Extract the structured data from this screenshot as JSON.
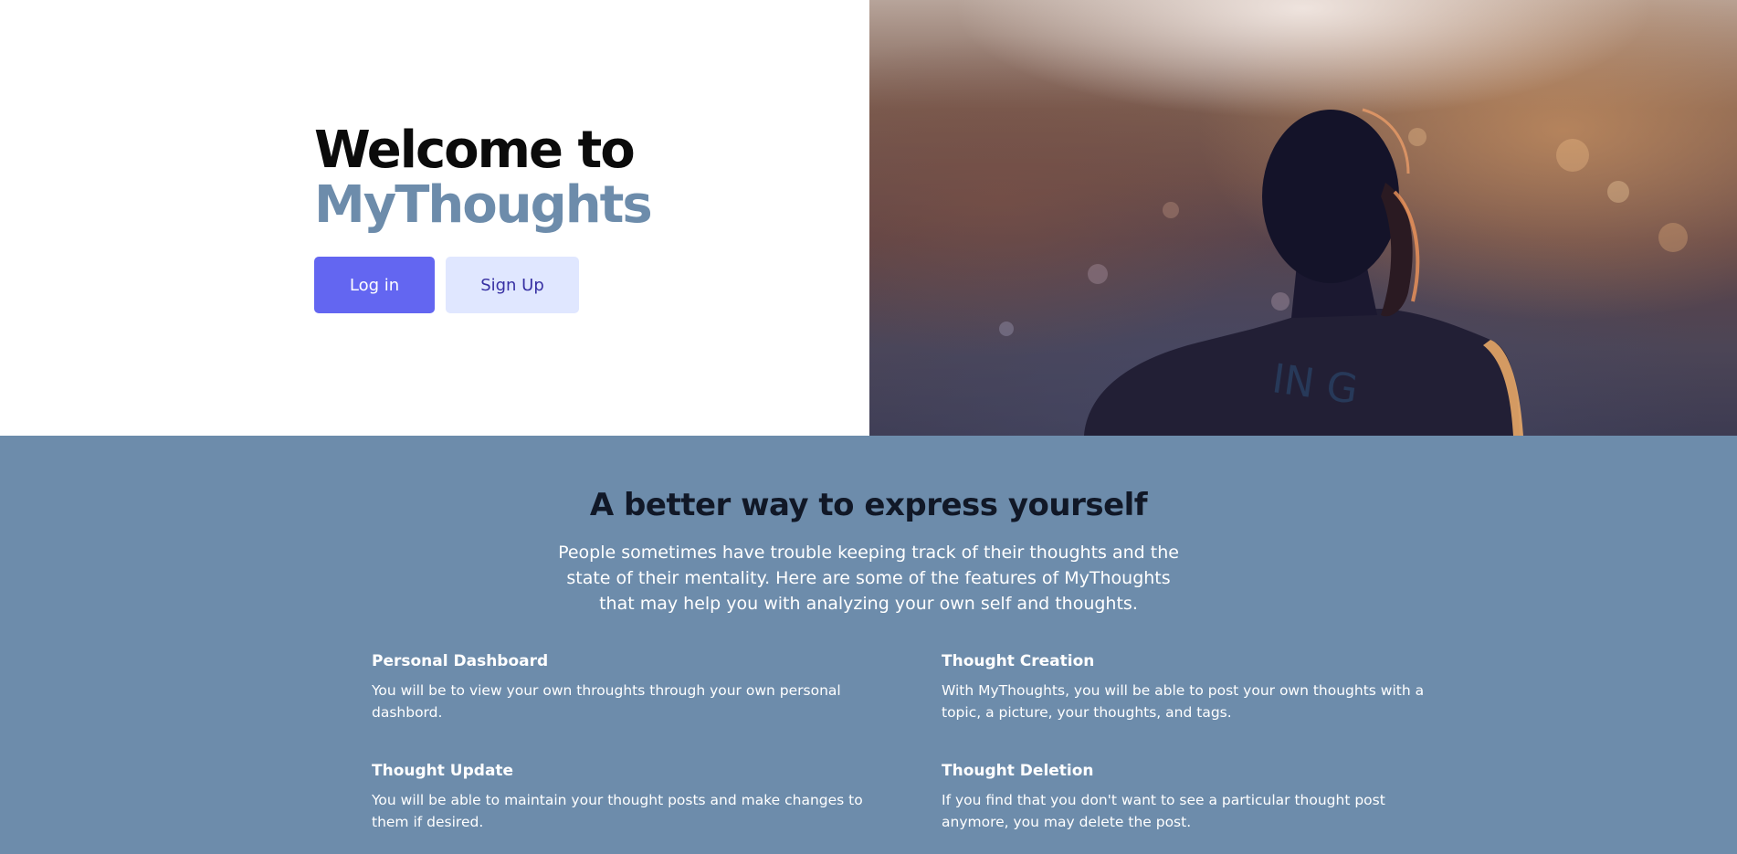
{
  "hero": {
    "title_line1": "Welcome to",
    "title_line2": "MyThoughts",
    "login_label": "Log in",
    "signup_label": "Sign Up"
  },
  "features": {
    "heading": "A better way to express yourself",
    "intro": "People sometimes have trouble keeping track of their thoughts and the state of their mentality. Here are some of the features of MyThoughts that may help you with analyzing your own self and thoughts.",
    "items": [
      {
        "title": "Personal Dashboard",
        "description": "You will be to view your own throughts through your own personal dashbord."
      },
      {
        "title": "Thought Creation",
        "description": "With MyThoughts, you will be able to post your own thoughts with a topic, a picture, your thoughts, and tags."
      },
      {
        "title": "Thought Update",
        "description": "You will be able to maintain your thought posts and make changes to them if desired."
      },
      {
        "title": "Thought Deletion",
        "description": "If you find that you don't want to see a particular thought post anymore, you may delete the post."
      }
    ]
  },
  "colors": {
    "brand": "#6d8cab",
    "primary_button": "#6366f1",
    "secondary_button": "#e0e7ff",
    "feature_background": "#6d8cab"
  }
}
